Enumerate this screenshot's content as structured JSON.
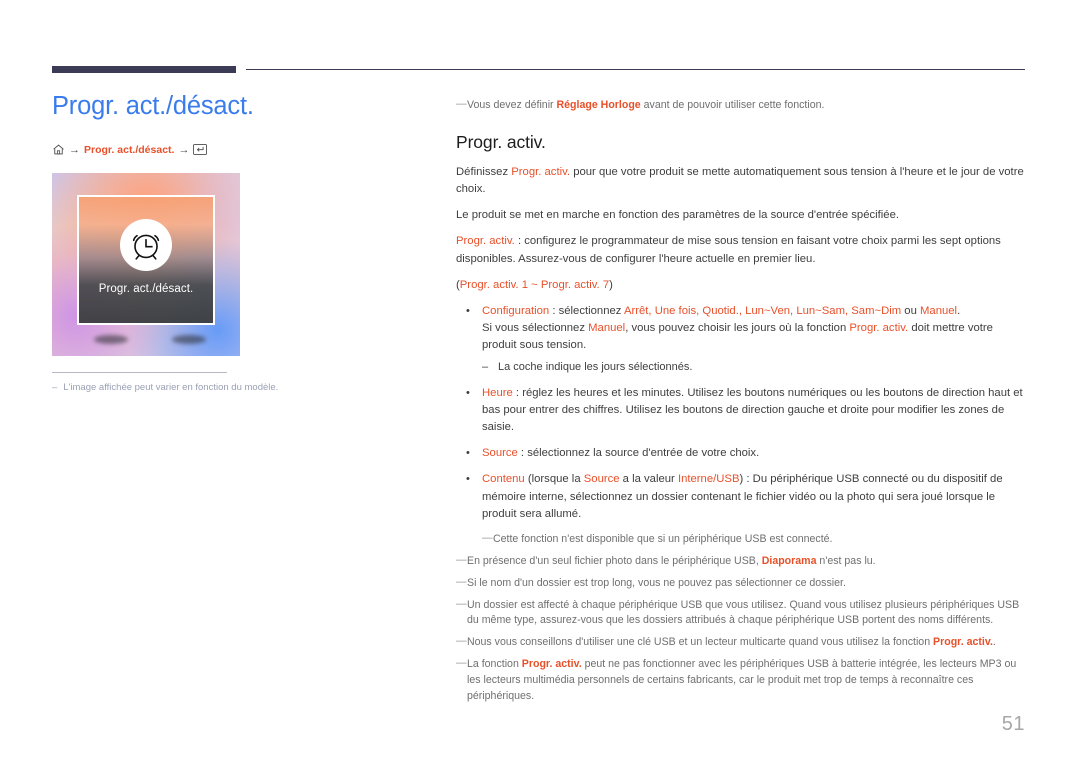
{
  "header": {
    "rule_color": "#3b3b55"
  },
  "left": {
    "page_title": "Progr. act./désact.",
    "breadcrumb": {
      "home_icon": "home-icon",
      "arrow1": "→",
      "path": "Progr. act./désact.",
      "arrow2": "→",
      "enter_icon": "enter-key-icon"
    },
    "thumbnail": {
      "label": "Progr. act./désact.",
      "icon": "alarm-clock-icon"
    },
    "image_note": {
      "dash": "–",
      "text": "L'image affichée peut varier en fonction du modèle."
    }
  },
  "right": {
    "top_note": {
      "marker": "―",
      "part1": "Vous devez définir ",
      "hl1": "Réglage Horloge",
      "part2": " avant de pouvoir utiliser cette fonction."
    },
    "section_title": "Progr. activ.",
    "p1": {
      "part1": "Définissez ",
      "hl1": "Progr. activ.",
      "part2": " pour que votre produit se mette automatiquement sous tension à l'heure et le jour de votre choix."
    },
    "p2": "Le produit se met en marche en fonction des paramètres de la source d'entrée spécifiée.",
    "p3": {
      "hl1": "Progr. activ.",
      "part2": " : configurez le programmateur de mise sous tension en faisant votre choix parmi les sept options disponibles. Assurez-vous de configurer l'heure actuelle en premier lieu."
    },
    "p4": {
      "open": "(",
      "hl1": "Progr. activ. 1 ~ Progr. activ. 7",
      "close": ")"
    },
    "bullets": [
      {
        "dot": "•",
        "label": "Configuration",
        "text1": " : sélectionnez ",
        "opts": "Arrêt, Une fois, Quotid., Lun~Ven, Lun~Sam, Sam~Dim",
        "text2": " ou ",
        "opt_last": "Manuel",
        "text3": ".",
        "line2_a": "Si vous sélectionnez ",
        "line2_hl": "Manuel",
        "line2_b": ", vous pouvez choisir les jours où la fonction ",
        "line2_hl2": "Progr. activ.",
        "line2_c": " doit mettre votre produit sous tension.",
        "sub": {
          "dash": "–",
          "text": "La coche indique les jours sélectionnés."
        }
      },
      {
        "dot": "•",
        "label": "Heure",
        "text1": " : réglez les heures et les minutes. Utilisez les boutons numériques ou les boutons de direction haut et bas pour entrer des chiffres. Utilisez les boutons de direction gauche et droite pour modifier les zones de saisie."
      },
      {
        "dot": "•",
        "label": "Source",
        "text1": " : sélectionnez la source d'entrée de votre choix."
      },
      {
        "dot": "•",
        "label": "Contenu",
        "text1": " (lorsque la ",
        "hl2": "Source",
        "text2": " a la valeur ",
        "hl3": "Interne/USB",
        "text3": ") : Du périphérique USB connecté ou du dispositif de mémoire interne, sélectionnez un dossier contenant le fichier vidéo ou la photo qui sera joué lorsque le produit sera allumé."
      }
    ],
    "notes": [
      {
        "marker": "―",
        "indent": true,
        "text": "Cette fonction n'est disponible que si un périphérique USB est connecté."
      },
      {
        "marker": "―",
        "indent": false,
        "part1": "En présence d'un seul fichier photo dans le périphérique USB, ",
        "hl1": "Diaporama",
        "part2": " n'est pas lu."
      },
      {
        "marker": "―",
        "indent": false,
        "text": "Si le nom d'un dossier est trop long, vous ne pouvez pas sélectionner ce dossier."
      },
      {
        "marker": "―",
        "indent": false,
        "text": "Un dossier est affecté à chaque périphérique USB que vous utilisez. Quand vous utilisez plusieurs périphériques USB du même type, assurez-vous que les dossiers attribués à chaque périphérique USB portent des noms différents."
      },
      {
        "marker": "―",
        "indent": false,
        "part1": "Nous vous conseillons d'utiliser une clé USB et un lecteur multicarte quand vous utilisez la fonction ",
        "hl1": "Progr. activ.",
        "part2": "."
      },
      {
        "marker": "―",
        "indent": false,
        "part1": "La fonction ",
        "hl1": "Progr. activ.",
        "part2": " peut ne pas fonctionner avec les périphériques USB à batterie intégrée, les lecteurs MP3 ou les lecteurs multimédia personnels de certains fabricants, car le produit met trop de temps à reconnaître ces périphériques."
      }
    ]
  },
  "footer": {
    "page_number": "51"
  },
  "colors": {
    "accent_orange": "#e8502a",
    "title_blue": "#3a7ceb",
    "rule_navy": "#3b3b55",
    "note_gray": "#6f6f6f"
  }
}
